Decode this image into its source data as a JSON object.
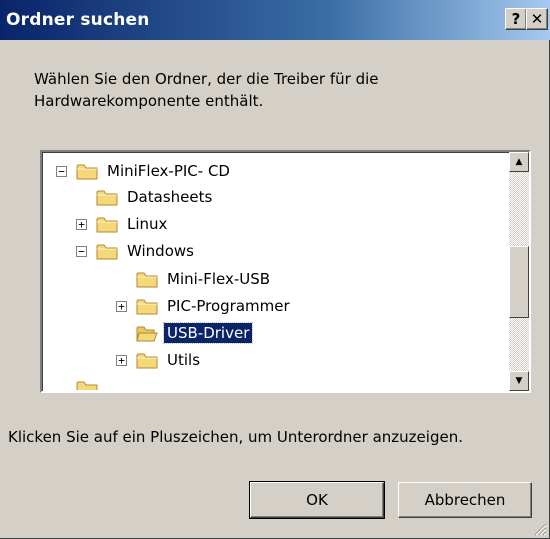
{
  "window": {
    "title": "Ordner suchen",
    "help_label": "?",
    "close_label": "✕"
  },
  "instruction": {
    "line1": "Wählen Sie den Ordner, der die Treiber für die",
    "line2": "Hardwarekomponente enthält."
  },
  "tree": {
    "items": [
      {
        "label": "MiniFlex-PIC- CD",
        "expander": "−"
      },
      {
        "label": "Datasheets",
        "expander": ""
      },
      {
        "label": "Linux",
        "expander": "+"
      },
      {
        "label": "Windows",
        "expander": "−"
      },
      {
        "label": "Mini-Flex-USB",
        "expander": ""
      },
      {
        "label": "PIC-Programmer",
        "expander": "+"
      },
      {
        "label": "USB-Driver",
        "expander": "",
        "selected": true
      },
      {
        "label": "Utils",
        "expander": "+"
      }
    ],
    "folder_icon": "folder-icon",
    "scroll_up_icon": "▲",
    "scroll_down_icon": "▼"
  },
  "hint": "Klicken Sie auf ein Pluszeichen, um Unterordner anzuzeigen.",
  "buttons": {
    "ok": "OK",
    "cancel": "Abbrechen"
  },
  "colors": {
    "titlebar": "#0a246a",
    "dialog_bg": "#d4d0c8",
    "selection": "#0a246a",
    "folder": "#f5d87a"
  }
}
